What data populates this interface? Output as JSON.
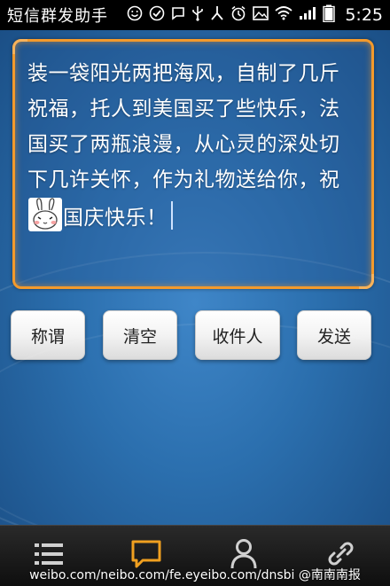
{
  "status_bar": {
    "app_title": "短信群发助手",
    "clock": "5:25",
    "icons": [
      "smiley-icon",
      "check-circle-icon",
      "chat-icon",
      "usb-icon",
      "share-icon",
      "alarm-icon",
      "picture-icon",
      "wifi-icon",
      "signal-icon",
      "battery-icon"
    ]
  },
  "message": {
    "text_before_emoticon": "装一袋阳光两把海风，自制了几斤祝福，托人到美国买了些快乐，法国买了两瓶浪漫，从心灵的深处切下几许关怀，作为礼物送给你，祝",
    "text_after_emoticon": "国庆快乐！"
  },
  "buttons": {
    "title_label": "称谓",
    "clear_label": "清空",
    "recipient_label": "收件人",
    "send_label": "发送"
  },
  "bottom_nav": {
    "items": [
      "list-icon",
      "message-icon",
      "contact-icon",
      "link-icon"
    ],
    "active_color": "#f0a020"
  },
  "watermark": {
    "text": "weibo.com/neibo.com/fe.eyeibo.com/dnsbi @南南南报"
  },
  "colors": {
    "accent": "#f39a2c",
    "background": "#2b6fae"
  }
}
